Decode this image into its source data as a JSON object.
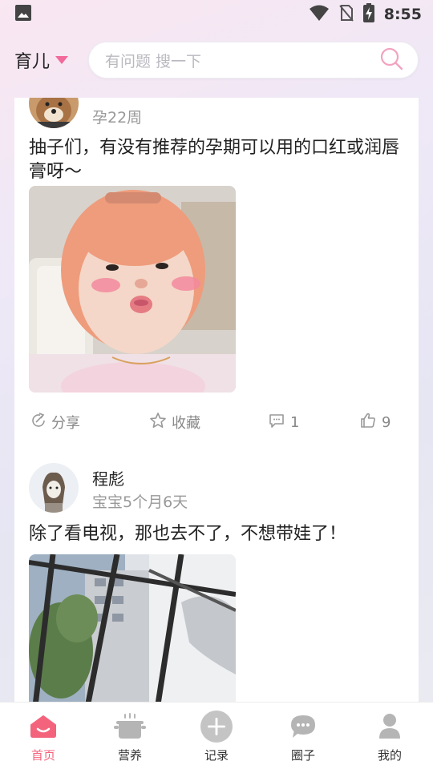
{
  "status_bar": {
    "time": "8:55"
  },
  "header": {
    "section": "育儿",
    "search_placeholder": "有问题 搜一下"
  },
  "posts": [
    {
      "author": "",
      "meta": "孕22周",
      "text": "抽子们，有没有推荐的孕期可以用的口红或润唇膏呀～",
      "actions": {
        "share": "分享",
        "favorite": "收藏",
        "comments": "1",
        "likes": "9"
      }
    },
    {
      "author": "程彪",
      "meta": "宝宝5个月6天",
      "text": "除了看电视，那也去不了，不想带娃了！"
    }
  ],
  "tabbar": {
    "items": [
      {
        "label": "首页",
        "icon": "home-icon"
      },
      {
        "label": "营养",
        "icon": "pot-icon"
      },
      {
        "label": "记录",
        "icon": "plus-icon"
      },
      {
        "label": "圈子",
        "icon": "chat-bubble-icon"
      },
      {
        "label": "我的",
        "icon": "user-icon"
      }
    ],
    "active_color": "#f4637c",
    "accent_color": "#f2699a"
  }
}
